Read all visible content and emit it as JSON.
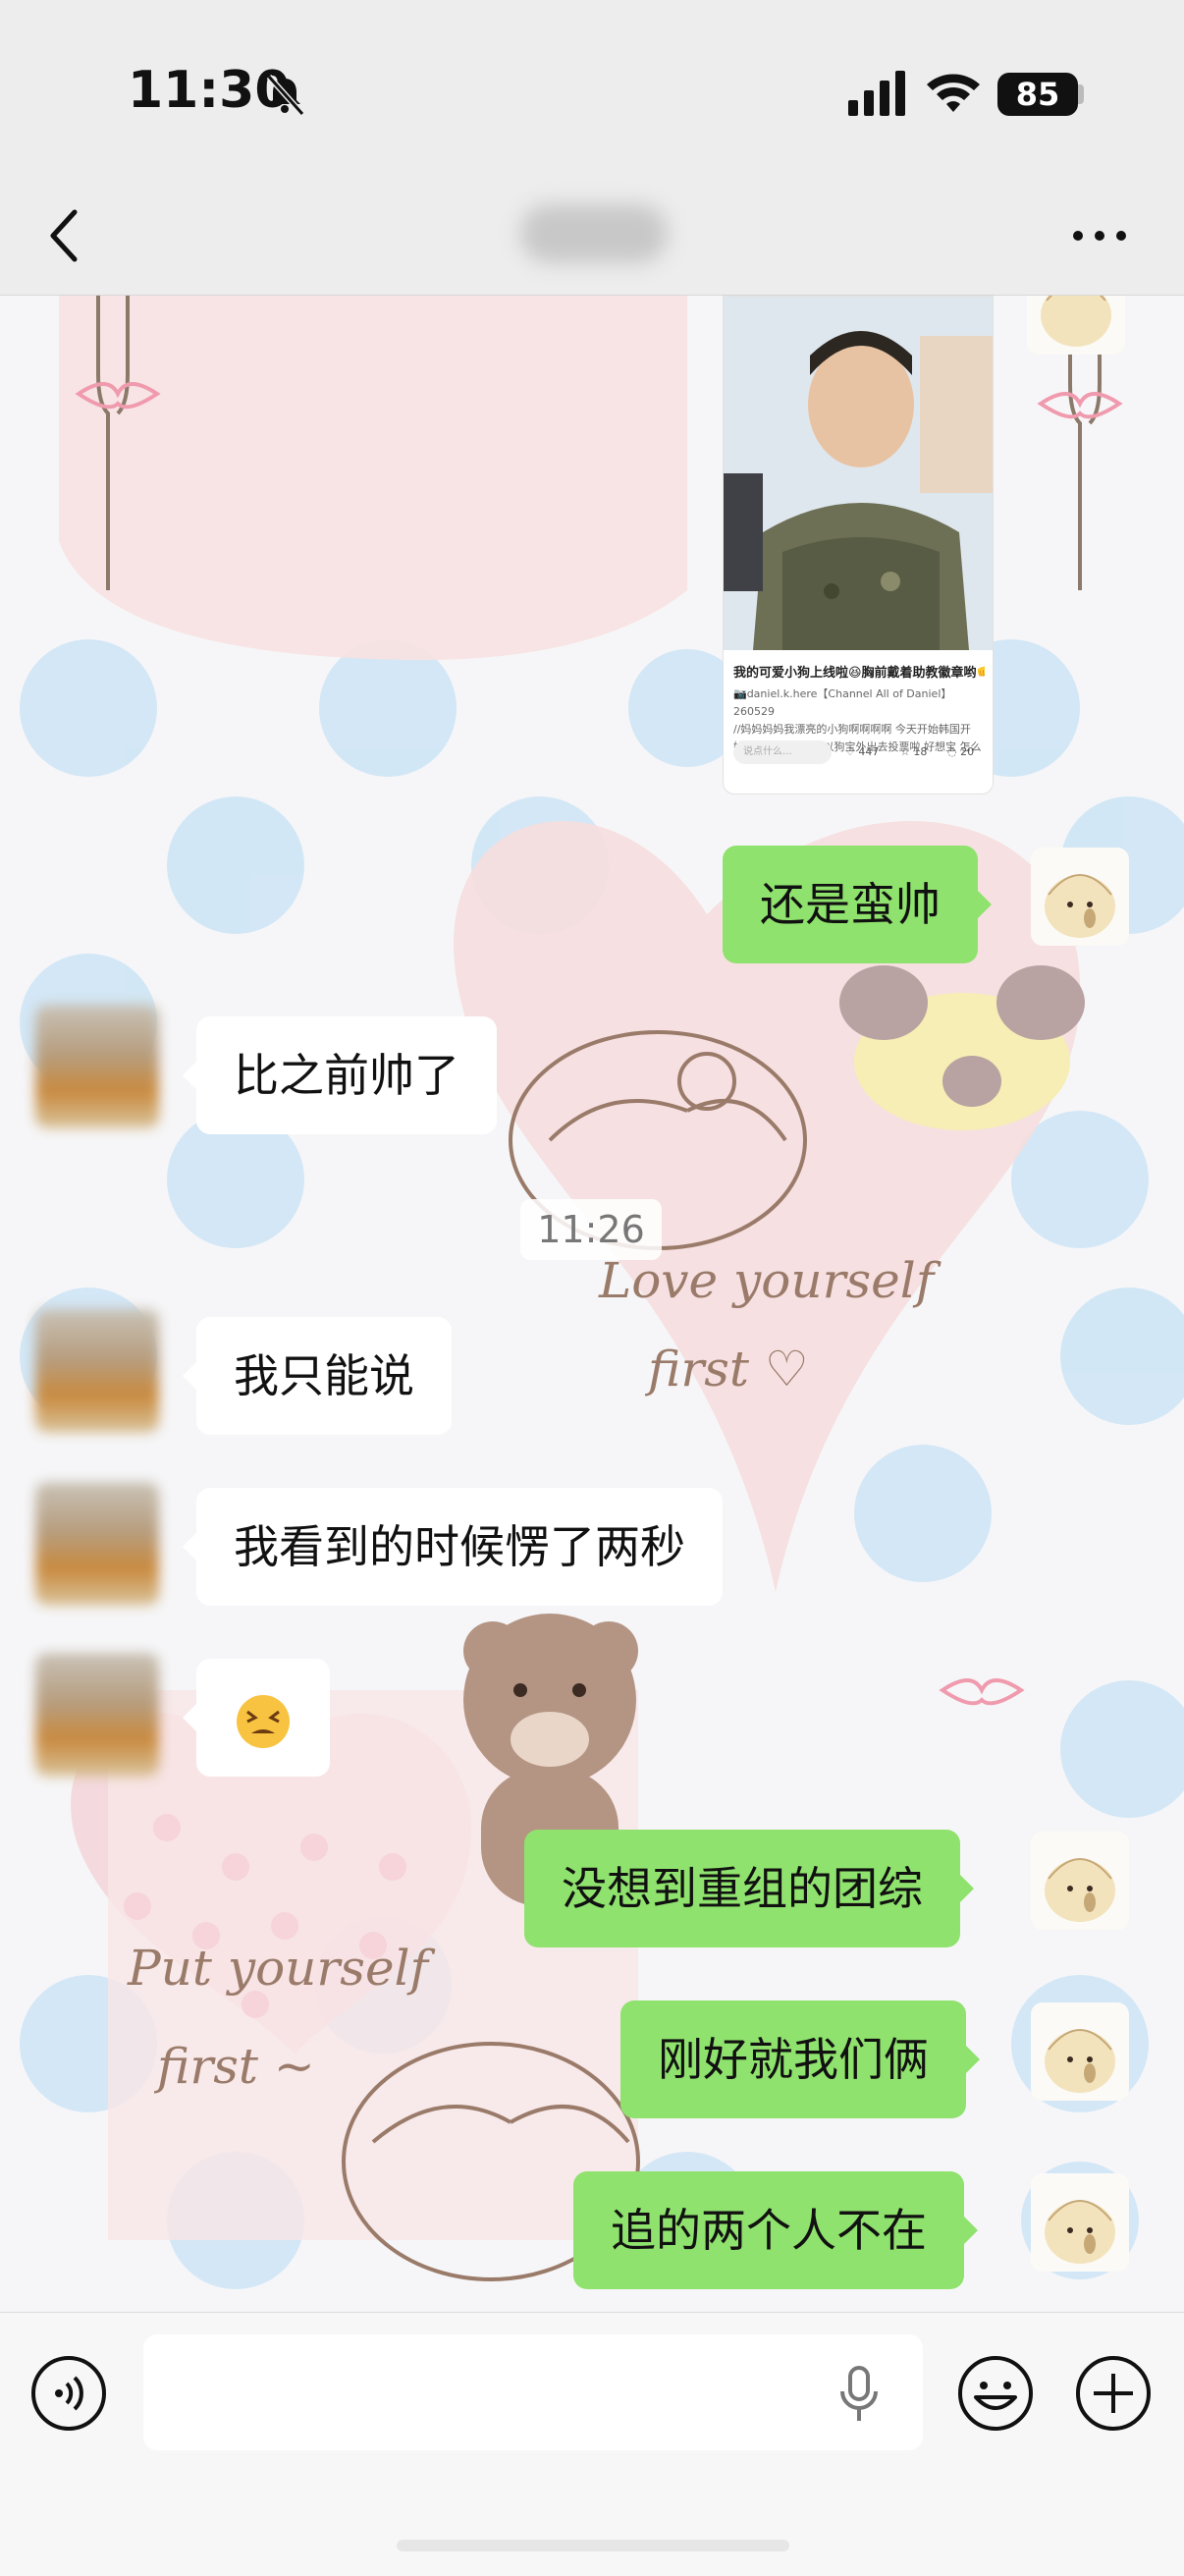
{
  "status_bar": {
    "time": "11:30",
    "battery": "85"
  },
  "nav": {
    "title": ""
  },
  "shared_card": {
    "title": "我的可爱小狗上线啦😆胸前戴着助教徽章哟👊",
    "desc_line1": "📷daniel.k.here【Channel All of Daniel】260529",
    "desc_line2": "//妈妈妈妈我漂亮的小狗啊啊啊啊 今天开始韩国开",
    "desc_line3": "始进行地方选举 所以狗宝外出去投票啦 好想宝 怎么",
    "input_placeholder": "说点什么...",
    "likes": "447",
    "favs": "18",
    "comments": "20"
  },
  "messages": [
    {
      "side": "me",
      "text": "还是蛮帅"
    },
    {
      "side": "other",
      "text": "比之前帅了"
    },
    {
      "side": "time",
      "text": "11:26"
    },
    {
      "side": "other",
      "text": "我只能说"
    },
    {
      "side": "other",
      "text": "我看到的时候愣了两秒"
    },
    {
      "side": "other",
      "text": "😖"
    },
    {
      "side": "me",
      "text": "没想到重组的团综"
    },
    {
      "side": "me",
      "text": "刚好就我们俩"
    },
    {
      "side": "me",
      "text": "追的两个人不在"
    }
  ],
  "wallpaper_text": {
    "line1": "Love yourself",
    "line2": "first",
    "line3": "Put yourself",
    "line4": "first ~"
  },
  "colors": {
    "my_bubble": "#8fe26d",
    "other_bubble": "#ffffff",
    "wallpaper_dot": "#cfe6f5",
    "wallpaper_heart": "#f6dede"
  }
}
